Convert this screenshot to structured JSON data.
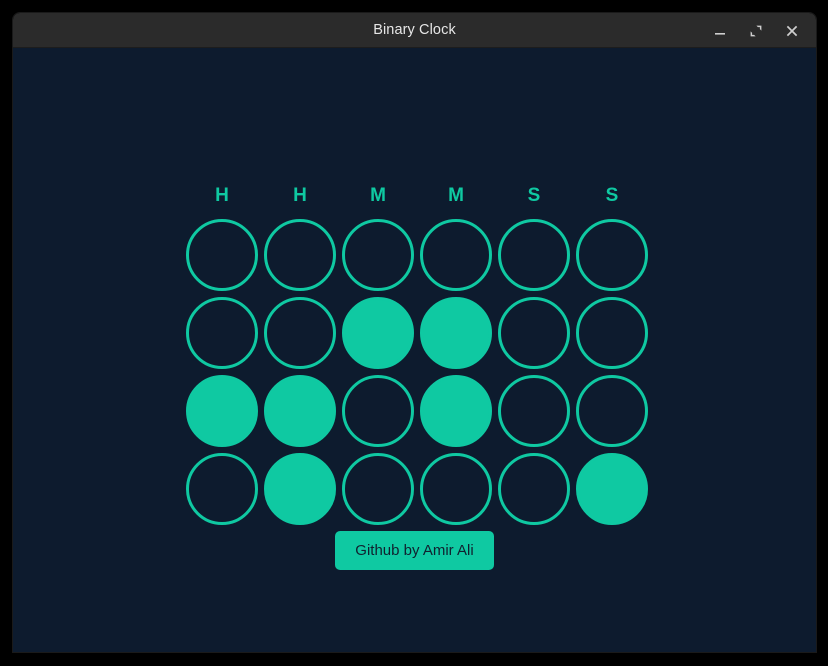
{
  "window": {
    "title": "Binary Clock",
    "controls": [
      {
        "name": "minimize-button",
        "label": "Minimize"
      },
      {
        "name": "maximize-button",
        "label": "Maximize"
      },
      {
        "name": "close-button",
        "label": "Close"
      }
    ]
  },
  "colors": {
    "accent": "#0fc9a2",
    "background": "#0d1b2e",
    "titlebar": "#2b2b2b",
    "titlebar_text": "#e6e6e6",
    "button_text": "#10212f",
    "desktop": "#000000"
  },
  "clock": {
    "headers": [
      "H",
      "H",
      "M",
      "M",
      "S",
      "S"
    ],
    "rows": 4,
    "columns": 6,
    "bits": [
      [
        0,
        0,
        0,
        0,
        0,
        0
      ],
      [
        0,
        0,
        1,
        1,
        0,
        0
      ],
      [
        1,
        1,
        0,
        1,
        0,
        0
      ],
      [
        0,
        1,
        0,
        0,
        0,
        1
      ]
    ],
    "column_values": [
      2,
      3,
      4,
      6,
      0,
      1
    ]
  },
  "footer": {
    "github_button_label": "Github by Amir Ali"
  }
}
